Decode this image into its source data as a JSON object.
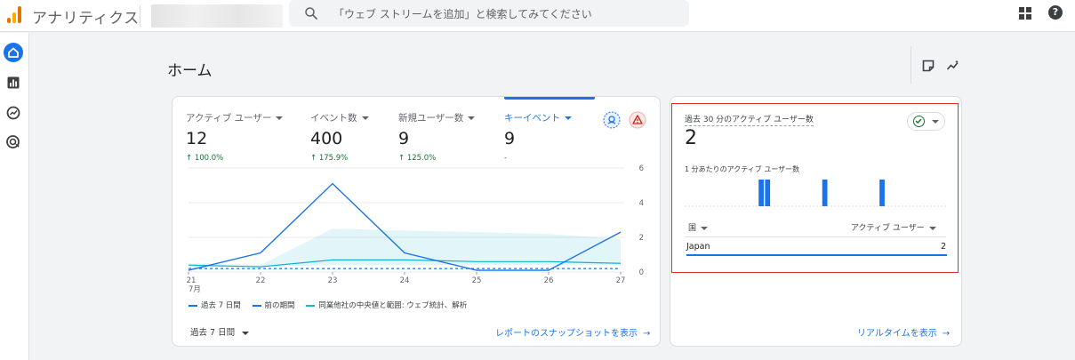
{
  "header": {
    "app_title": "アナリティクス",
    "search_placeholder": "「ウェブ ストリームを追加」と検索してみてください",
    "icons": [
      "analytics-logo-icon",
      "search-icon",
      "apps-grid-icon",
      "help-icon"
    ]
  },
  "sidebar": {
    "items": [
      {
        "name": "home",
        "icon": "home-icon",
        "active": true
      },
      {
        "name": "reports",
        "icon": "bar-chart-icon",
        "active": false
      },
      {
        "name": "explore",
        "icon": "explore-icon",
        "active": false
      },
      {
        "name": "advertising",
        "icon": "target-icon",
        "active": false
      }
    ]
  },
  "page": {
    "title": "ホーム",
    "header_icons": [
      "note-icon",
      "insights-icon"
    ]
  },
  "overview": {
    "metrics": [
      {
        "label": "アクティブ ユーザー",
        "value": "12",
        "delta": "↑ 100.0%"
      },
      {
        "label": "イベント数",
        "value": "400",
        "delta": "↑ 175.9%"
      },
      {
        "label": "新規ユーザー数",
        "value": "9",
        "delta": "↑ 125.0%"
      },
      {
        "label": "キーイベント",
        "value": "9",
        "delta": "-"
      }
    ],
    "legend": {
      "current": "過去 7 日間",
      "previous": "前の期間",
      "benchmark": "同業他社の中央値と範囲: ウェブ統計、解析"
    },
    "period_select": "過去 7 日間",
    "snapshot_link": "レポートのスナップショットを表示",
    "arrow": "→"
  },
  "chart_data": {
    "type": "line",
    "x": [
      "21",
      "22",
      "23",
      "24",
      "25",
      "26",
      "27"
    ],
    "x_month_label": "7月",
    "ylim": [
      0,
      6
    ],
    "y_ticks": [
      "0",
      "2",
      "4",
      "6"
    ],
    "series": [
      {
        "name": "過去 7 日間",
        "values": [
          0.1,
          1.1,
          5.1,
          1.1,
          0.1,
          0.1,
          2.3
        ]
      },
      {
        "name": "前の期間",
        "values": [
          0.2,
          0.2,
          0.2,
          0.2,
          0.2,
          0.2,
          0.2
        ]
      },
      {
        "name": "同業他社の中央値と範囲: ウェブ統計、解析",
        "values": [
          0.4,
          0.3,
          0.7,
          0.7,
          0.6,
          0.6,
          0.5
        ],
        "range_low": [
          0.3,
          0.3,
          0.4,
          0.4,
          0.4,
          0.4,
          0.4
        ],
        "range_high": [
          0.5,
          0.4,
          2.5,
          2.4,
          2.3,
          2.2,
          1.9
        ]
      }
    ],
    "grid": true
  },
  "realtime": {
    "label": "過去 30 分のアクティブ ユーザー数",
    "value": "2",
    "per_minute_label": "1 分あたりのアクティブ ユーザー数",
    "per_minute_values": [
      0,
      0,
      0,
      0,
      0,
      0,
      0,
      0,
      0,
      0,
      0,
      1,
      1,
      0,
      0,
      0,
      0,
      0,
      0,
      0,
      0,
      1,
      0,
      0,
      0,
      0,
      0,
      0,
      0,
      0,
      1,
      0,
      0,
      0,
      0,
      0,
      0,
      0,
      0,
      0
    ],
    "col_country": "国",
    "col_users": "アクティブ ユーザー",
    "rows": [
      {
        "country": "Japan",
        "users": "2"
      }
    ],
    "link": "リアルタイムを表示",
    "arrow": "→"
  }
}
